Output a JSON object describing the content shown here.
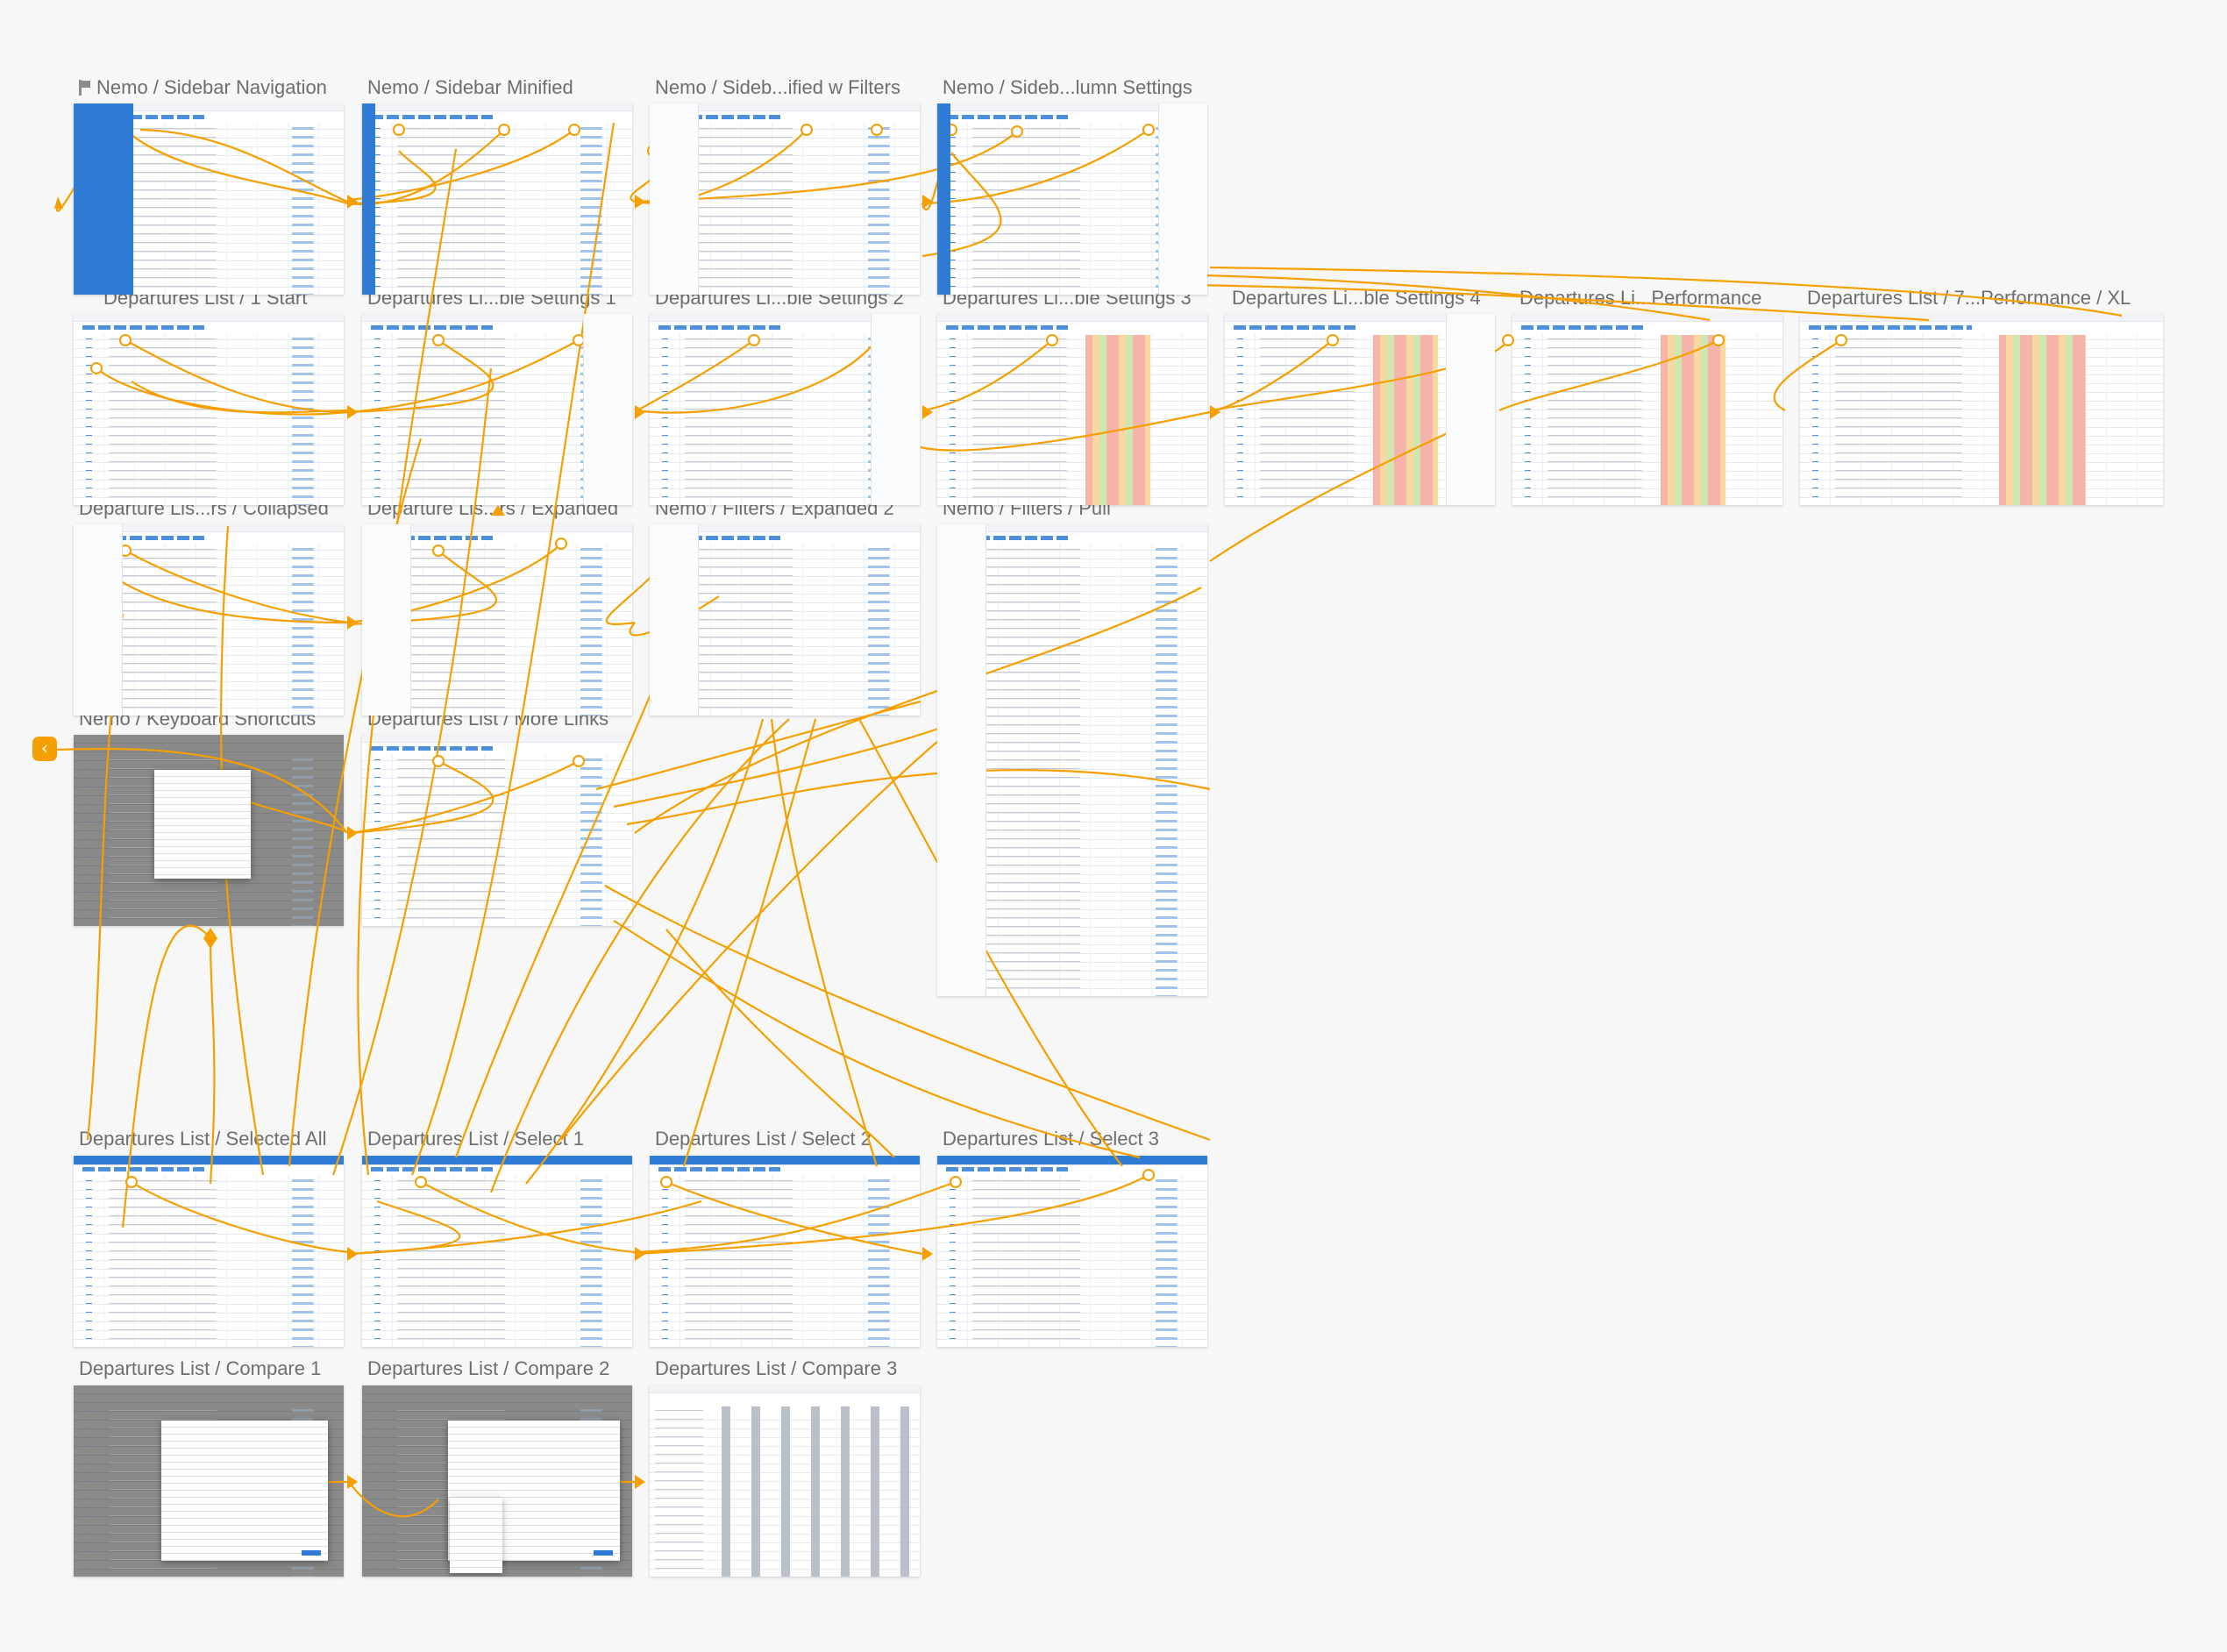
{
  "canvas": {
    "background": "#f7f7f7",
    "accent": "#2f7bd6",
    "flow_color": "#f5a000"
  },
  "boards": {
    "b01": "Nemo / Sidebar Navigation",
    "b02": "Nemo / Sidebar Minified",
    "b03": "Nemo / Sideb...ified w Filters",
    "b04": "Nemo / Sideb...lumn Settings",
    "b05": "Departures List / 1 Start",
    "b06": "Departures Li...ble Settings 1",
    "b07": "Departures Li...ble Settings 2",
    "b08": "Departures Li...ble Settings 3",
    "b09": "Departures Li...ble Settings 4",
    "b10": "Departures Li...Performance",
    "b11": "Departures List / 7...Performance / XL",
    "b12": "Departure Lis...rs / Collapsed",
    "b13": "Departure Lis...rs / Expanded",
    "b14": "Nemo / Filters / Expanded 2",
    "b15": "Nemo / Filters / Pull",
    "b16": "Nemo / Keyboard Shortcuts",
    "b17": "Departures List / More Links",
    "b18": "Departures List / Selected All",
    "b19": "Departures List / Select 1",
    "b20": "Departures List / Select 2",
    "b21": "Departures List / Select 3",
    "b22": "Departures List / Compare 1",
    "b23": "Departures List / Compare 2",
    "b24": "Departures List / Compare 3"
  },
  "icons": {
    "start_flag": "flag-icon",
    "back": "chevron-left-icon"
  },
  "back_glyph": "‹"
}
